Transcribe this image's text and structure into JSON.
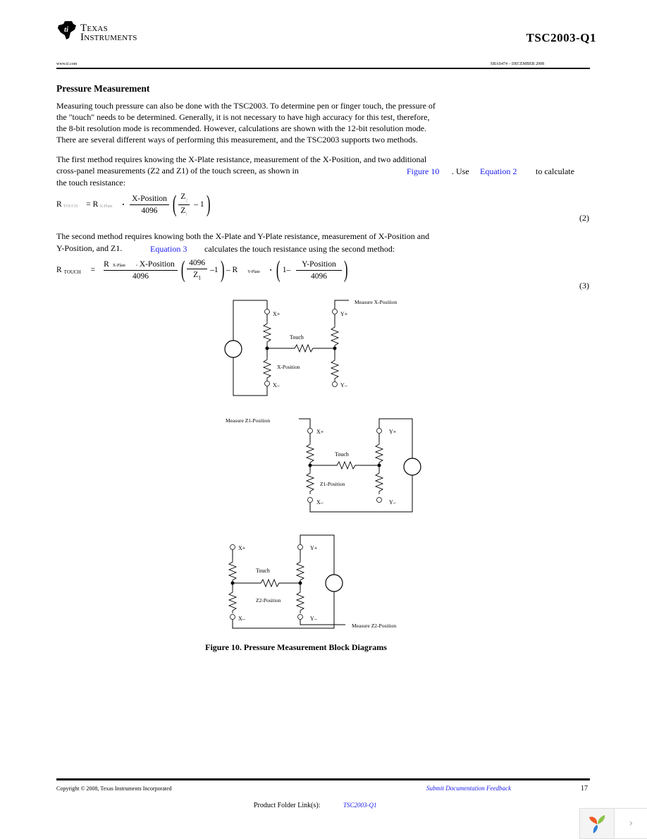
{
  "header": {
    "logo_line1": "Texas",
    "logo_line2": "Instruments",
    "doc_id": "TSC2003-Q1",
    "website": "www.ti.com",
    "doc_number": "SBAS474 – DECEMBER 2008"
  },
  "section": {
    "title": "Pressure Measurement",
    "para1": [
      "Measuring touch pressure can also be done with the TSC2003. To determine pen or finger touch, the pressure of",
      "the \"touch\" needs to be determined. Generally, it is not necessary to have high accuracy for this test, therefore,",
      "the 8-bit resolution mode is recommended. However, calculations are shown with the 12-bit resolution mode.",
      "There are several different ways of performing this measurement, and the TSC2003 supports two methods."
    ],
    "para2_line1": "The first method requires knowing the X-Plate resistance, measurement of the X-Position, and two additional",
    "para2_line2a": "cross-panel measurements (Z2 and Z1) of the touch screen, as shown in",
    "para2_link1": "Figure 10",
    "para2_mid": ". Use",
    "para2_link2": "Equation 2",
    "para2_end": "to calculate",
    "para2_line3": "the touch resistance:",
    "para3_line1": "The second method requires knowing both the X-Plate and Y-Plate resistance, measurement of X-Position and",
    "para3_line2a": "Y-Position, and Z1.",
    "para3_link": "Equation 3",
    "para3_end": "calculates the touch resistance using the second method:"
  },
  "equation2": {
    "lhs": "R",
    "lhs_sub": "TOUCH",
    "eq_r": "= R",
    "eq_r_sub": "X-Plate",
    "dot": "▪",
    "num": "X-Position",
    "den": "4096",
    "z_num": "Z",
    "z_num_sub": "2",
    "z_den": "Z",
    "z_den_sub": "1",
    "minus_one": "– 1",
    "number": "(2)"
  },
  "equation3": {
    "lhs": "R",
    "lhs_sub": "TOUCH",
    "equals": "=",
    "num_r": "R",
    "num_r_sub": "X-Plate",
    "num_dot": "▪",
    "num_pos": "X-Position",
    "den": "4096",
    "p1_num": "4096",
    "p1_den": "Z",
    "p1_den_sub": "1",
    "p1_minus": "–1",
    "minus_r": "– R",
    "r_sub": "Y-Plate",
    "dot": "▪",
    "p2_one": "1–",
    "p2_num": "Y-Position",
    "p2_den": "4096",
    "number": "(3)"
  },
  "figure": {
    "caption": "Figure 10. Pressure Measurement Block Diagrams",
    "diagram1": {
      "xp": "X+",
      "xm": "X–",
      "yp": "Y+",
      "ym": "Y–",
      "touch": "Touch",
      "pos": "X-Position",
      "measure": "Measure X-Position"
    },
    "diagram2": {
      "xp": "X+",
      "xm": "X–",
      "yp": "Y+",
      "ym": "Y–",
      "touch": "Touch",
      "pos": "Z1-Position",
      "measure": "Measure Z1-Position"
    },
    "diagram3": {
      "xp": "X+",
      "xm": "X–",
      "yp": "Y+",
      "ym": "Y–",
      "touch": "Touch",
      "pos": "Z2-Position",
      "measure": "Measure Z2-Position"
    }
  },
  "footer": {
    "copyright": "Copyright © 2008, Texas Instruments Incorporated",
    "feedback_link": "Submit Documentation Feedback",
    "page_number": "17",
    "product_label": "Product Folder Link(s):",
    "product_link": "TSC2003-Q1"
  },
  "widget": {
    "logo_icon": "app-logo-icon",
    "next_icon": "›"
  }
}
